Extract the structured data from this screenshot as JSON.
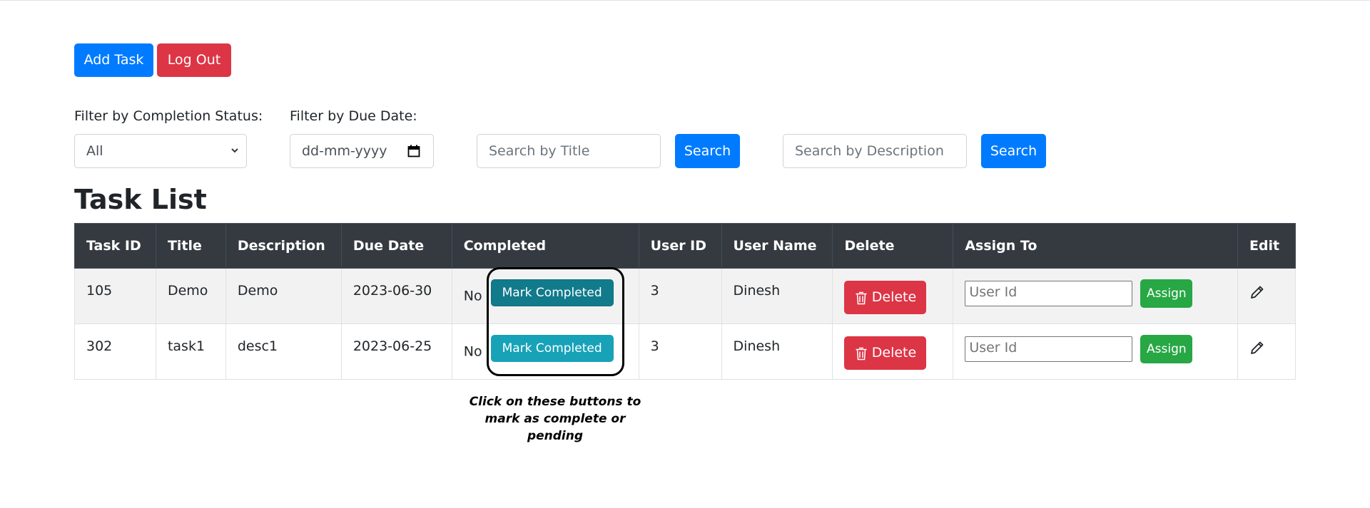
{
  "toolbar": {
    "add_task_label": "Add Task",
    "log_out_label": "Log Out"
  },
  "filters": {
    "status_label": "Filter by Completion Status:",
    "status_selected": "All",
    "due_label": "Filter by Due Date:",
    "due_placeholder": "dd-mm-yyyy",
    "title_search_placeholder": "Search by Title",
    "title_search_button": "Search",
    "desc_search_placeholder": "Search by Description",
    "desc_search_button": "Search"
  },
  "task_list": {
    "title": "Task List",
    "columns": [
      "Task ID",
      "Title",
      "Description",
      "Due Date",
      "Completed",
      "User ID",
      "User Name",
      "Delete",
      "Assign To",
      "Edit"
    ],
    "rows": [
      {
        "task_id": "105",
        "title": "Demo",
        "description": "Demo",
        "due_date": "2023-06-30",
        "completed": "No",
        "mark_label": "Mark Completed",
        "user_id": "3",
        "user_name": "Dinesh",
        "delete_label": "Delete",
        "assign_placeholder": "User Id",
        "assign_label": "Assign"
      },
      {
        "task_id": "302",
        "title": "task1",
        "description": "desc1",
        "due_date": "2023-06-25",
        "completed": "No",
        "mark_label": "Mark Completed",
        "user_id": "3",
        "user_name": "Dinesh",
        "delete_label": "Delete",
        "assign_placeholder": "User Id",
        "assign_label": "Assign"
      }
    ]
  },
  "annotation": {
    "text": "Click on these buttons to mark as complete or pending"
  },
  "icons": {
    "delete": "trash-icon",
    "edit": "pencil-icon",
    "select": "chevron-down-icon",
    "date": "calendar-icon"
  },
  "colors": {
    "primary": "#007bff",
    "danger": "#dc3545",
    "success": "#28a745",
    "info": "#17a2b8",
    "info_active": "#117a8b",
    "header_bg": "#343a40"
  }
}
